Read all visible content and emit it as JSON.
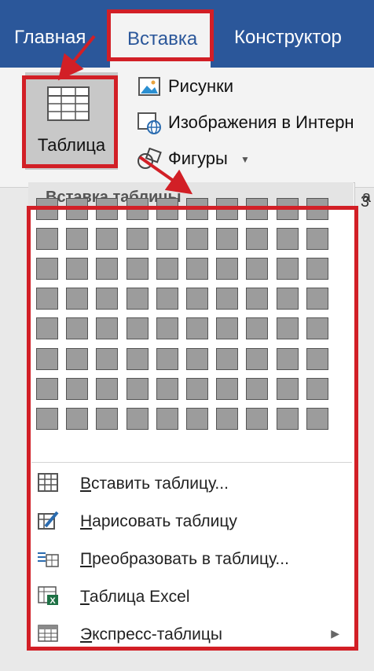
{
  "tabs": [
    {
      "label": "Главная"
    },
    {
      "label": "Вставка"
    },
    {
      "label": "Конструктор"
    }
  ],
  "ribbon": {
    "table_button_label": "Таблица",
    "items": [
      {
        "label": "Рисунки",
        "icon": "pictures-icon"
      },
      {
        "label": "Изображения в Интерн",
        "icon": "online-pictures-icon"
      },
      {
        "label": "Фигуры",
        "icon": "shapes-icon"
      }
    ],
    "right_cut": [
      "a",
      "3"
    ]
  },
  "menu": {
    "header": "Вставка таблицы",
    "grid": {
      "columns": 10,
      "rows": 8
    },
    "items": [
      {
        "label": "Вставить таблицу...",
        "icon": "insert-table-icon",
        "submenu": false
      },
      {
        "label": "Нарисовать таблицу",
        "icon": "draw-table-icon",
        "submenu": false
      },
      {
        "label": "Преобразовать в таблицу...",
        "icon": "convert-to-table-icon",
        "submenu": false
      },
      {
        "label": "Таблица Excel",
        "icon": "excel-table-icon",
        "submenu": false
      },
      {
        "label": "Экспресс-таблицы",
        "icon": "quick-tables-icon",
        "submenu": true
      }
    ]
  },
  "colors": {
    "tab_bar": "#2b579a",
    "highlight": "#d21f26",
    "grid_cell": "#9c9c9c"
  }
}
